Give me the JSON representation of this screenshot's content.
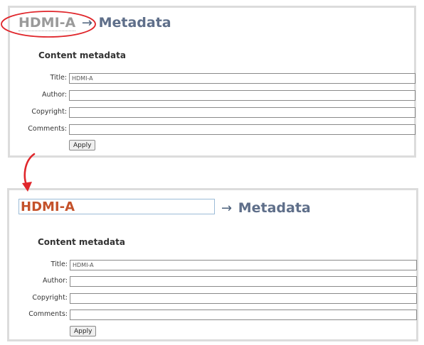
{
  "panel_before": {
    "channel_name": "HDMI-A",
    "arrow": "→",
    "page_title": "Metadata",
    "section_title": "Content metadata",
    "fields": [
      {
        "label": "Title:",
        "value": "HDMI-A"
      },
      {
        "label": "Author:",
        "value": ""
      },
      {
        "label": "Copyright:",
        "value": ""
      },
      {
        "label": "Comments:",
        "value": ""
      }
    ],
    "apply_label": "Apply"
  },
  "panel_after": {
    "channel_name_input_value": "HDMI-A",
    "arrow": "→",
    "page_title": "Metadata",
    "section_title": "Content metadata",
    "fields": [
      {
        "label": "Title:",
        "value": "HDMI-A"
      },
      {
        "label": "Author:",
        "value": ""
      },
      {
        "label": "Copyright:",
        "value": ""
      },
      {
        "label": "Comments:",
        "value": ""
      }
    ],
    "apply_label": "Apply"
  },
  "colors": {
    "annotation_red": "#e0262b",
    "channel_name_edit": "#c4512a",
    "title_blue": "#5f6f8a"
  },
  "icons": [
    "right-arrow-glyph",
    "curved-down-arrow-icon",
    "highlight-ellipse-icon"
  ]
}
